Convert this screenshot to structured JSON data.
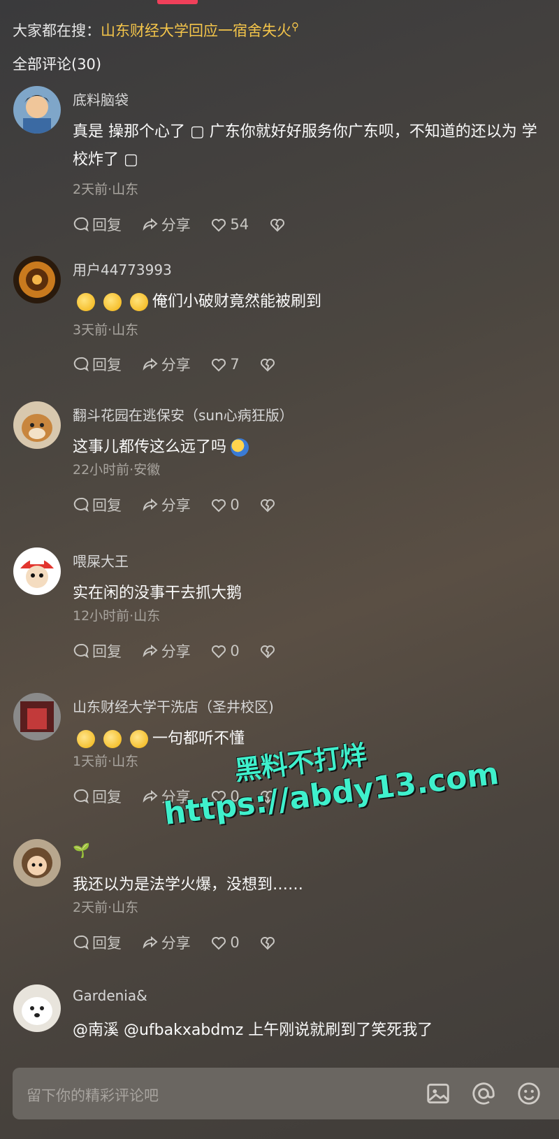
{
  "trending": {
    "prefix": "大家都在搜：",
    "query": "山东财经大学回应一宿舍失火"
  },
  "comment_count": "全部评论(30)",
  "actions": {
    "reply": "回复",
    "share": "分享"
  },
  "comments": [
    {
      "username": "底料脑袋",
      "text": "真是 操那个心了 ▢ 广东你就好好服务你广东呗，不知道的还以为 学校炸了 ▢",
      "meta": "2天前·山东",
      "likes": "54",
      "emoji": "cat"
    },
    {
      "username": "用户44773993",
      "text": "俺们小破财竟然能被刷到",
      "meta": "3天前·山东",
      "likes": "7",
      "emoji": "think"
    },
    {
      "username": "翻斗花园在逃保安（sun心病狂版）",
      "text": "这事儿都传这么远了吗",
      "meta": "22小时前·安徽",
      "likes": "0",
      "emoji": "blue"
    },
    {
      "username": "喂屎大王",
      "text": "实在闲的没事干去抓大鹅",
      "meta": "12小时前·山东",
      "likes": "0",
      "emoji": ""
    },
    {
      "username": "山东财经大学干洗店（圣井校区)",
      "text": "一句都听不懂",
      "meta": "1天前·山东",
      "likes": "0",
      "emoji": "pray"
    },
    {
      "username": "🌱",
      "text": "我还以为是法学火爆，没想到……",
      "meta": "2天前·山东",
      "likes": "0",
      "emoji": ""
    },
    {
      "username": "Gardenia&",
      "text": "@南溪  @ufbakxabdmz  上午刚说就刷到了笑死我了",
      "meta": "",
      "likes": "",
      "emoji": ""
    }
  ],
  "watermark": {
    "line1": "黑料不打烊",
    "line2": "https://abdy13.com"
  },
  "input": {
    "placeholder": "留下你的精彩评论吧"
  }
}
